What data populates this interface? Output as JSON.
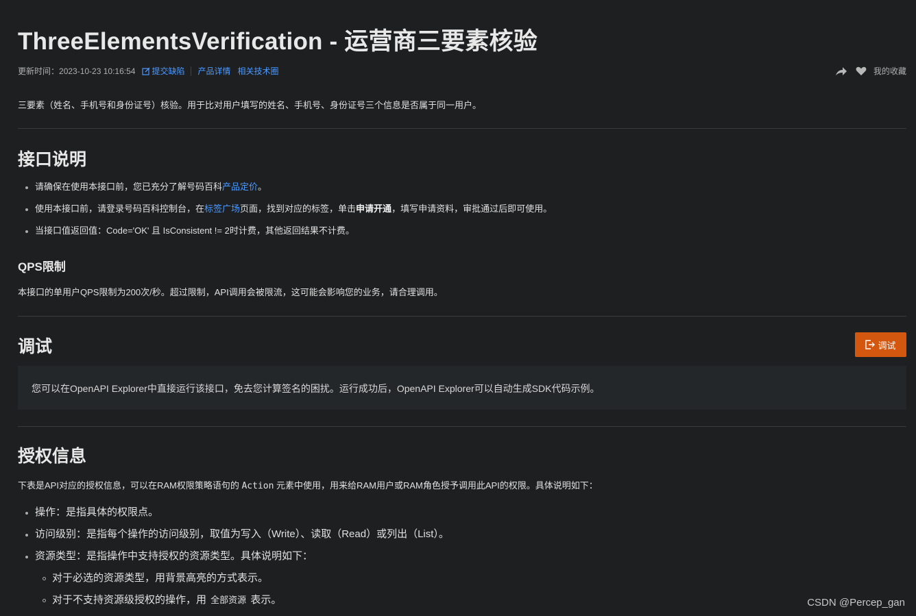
{
  "header": {
    "title": "ThreeElementsVerification - 运营商三要素核验",
    "updated_label": "更新时间：",
    "updated_time": "2023-10-23 10:16:54",
    "report_bug": "提交缺陷",
    "product_detail": "产品详情",
    "related_circle": "相关技术圈",
    "favorites": "我的收藏"
  },
  "intro": "三要素（姓名、手机号和身份证号）核验。用于比对用户填写的姓名、手机号、身份证号三个信息是否属于同一用户。",
  "api_desc": {
    "heading": "接口说明",
    "items": [
      {
        "before": "请确保在使用本接口前，您已充分了解号码百科",
        "link": "产品定价",
        "after": "。"
      },
      {
        "before": "使用本接口前，请登录号码百科控制台，在",
        "link": "标签广场",
        "middle": "页面，找到对应的标签，单击",
        "bold": "申请开通",
        "after": "，填写申请资料，审批通过后即可使用。"
      },
      {
        "text": "当接口值返回值：Code='OK' 且 IsConsistent != 2时计费，其他返回结果不计费。"
      }
    ]
  },
  "qps": {
    "heading": "QPS限制",
    "text": "本接口的单用户QPS限制为200次/秒。超过限制，API调用会被限流，这可能会影响您的业务，请合理调用。"
  },
  "debug": {
    "heading": "调试",
    "button": "调试",
    "note": "您可以在OpenAPI Explorer中直接运行该接口，免去您计算签名的困扰。运行成功后，OpenAPI Explorer可以自动生成SDK代码示例。"
  },
  "auth": {
    "heading": "授权信息",
    "desc_before": "下表是API对应的授权信息，可以在RAM权限策略语句的 ",
    "desc_code": "Action",
    "desc_after": " 元素中使用，用来给RAM用户或RAM角色授予调用此API的权限。具体说明如下：",
    "items": [
      "操作：是指具体的权限点。",
      "访问级别：是指每个操作的访问级别，取值为写入（Write）、读取（Read）或列出（List）。",
      "资源类型：是指操作中支持授权的资源类型。具体说明如下："
    ],
    "sub_items": {
      "required": "对于必选的资源类型，用背景高亮的方式表示。",
      "unsupported_before": "对于不支持资源级授权的操作，用 ",
      "unsupported_chip": "全部资源",
      "unsupported_after": " 表示。"
    }
  },
  "watermark": "CSDN @Percep_gan",
  "colors": {
    "accent": "#4c9aff",
    "button": "#d4570f",
    "background": "#1e1f21"
  }
}
